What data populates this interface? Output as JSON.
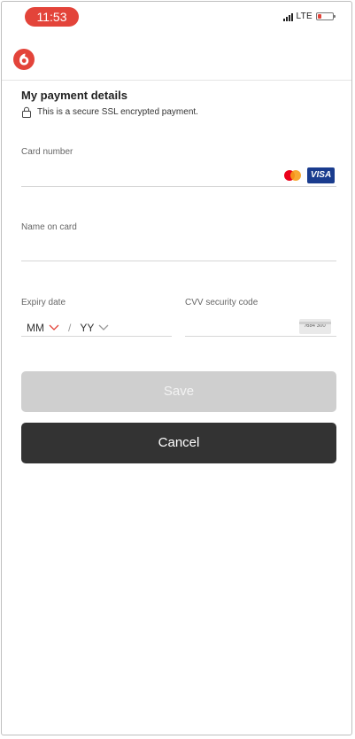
{
  "status_bar": {
    "time": "11:53",
    "network": "LTE"
  },
  "header": {
    "logo_icon": "vodafone-logo-icon"
  },
  "page": {
    "title": "My payment details",
    "secure_note": "This is a secure SSL encrypted payment."
  },
  "form": {
    "card_number": {
      "label": "Card number",
      "value": ""
    },
    "name_on_card": {
      "label": "Name on card",
      "value": ""
    },
    "expiry": {
      "label": "Expiry date",
      "month": "MM",
      "year": "YY"
    },
    "cvv": {
      "label": "CVV security code",
      "card_hint": "/684 300"
    }
  },
  "buttons": {
    "save": "Save",
    "cancel": "Cancel"
  },
  "colors": {
    "brand_red": "#e3443a",
    "save_disabled": "#cfcfcf",
    "cancel_dark": "#333333"
  }
}
